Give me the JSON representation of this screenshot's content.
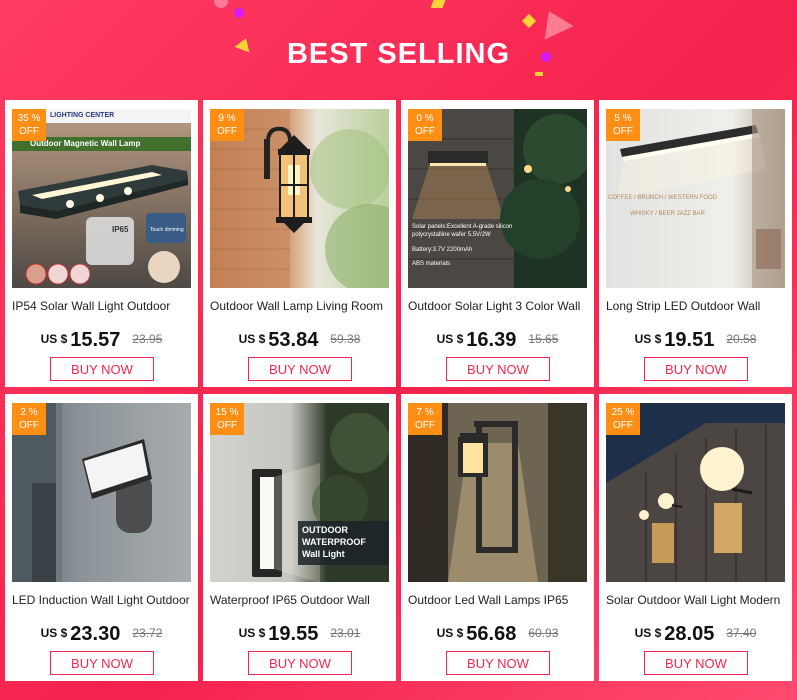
{
  "header": {
    "title": "BEST SELLING"
  },
  "currency": "US $",
  "buy_label": "BUY NOW",
  "colors": {
    "accent": "#f4284f",
    "badge": "#ff8e14",
    "background": "#f4224d"
  },
  "products": [
    {
      "discount": "35 %",
      "off": "OFF",
      "name": "IP54 Solar Wall Light Outdoor",
      "price": "15.57",
      "old_price": "23.95",
      "image_text": {
        "brand": "LIGHTING CENTER",
        "headline": "Outdoor Magnetic Wall Lamp",
        "rating": "IP65",
        "note": "Touch dimming"
      }
    },
    {
      "discount": "9 %",
      "off": "OFF",
      "name": "Outdoor Wall Lamp Living Room",
      "price": "53.84",
      "old_price": "59.38"
    },
    {
      "discount": "0 %",
      "off": "OFF",
      "name": "Outdoor Solar Light 3 Color Wall",
      "price": "16.39",
      "old_price": "15.65",
      "image_text": {
        "spec1": "Solar panels:Excellent A-grade silicon polycrystalline wafer 5.5V/2W",
        "spec2": "Battery:3.7V 2200mAh",
        "spec3": "ABS materials"
      }
    },
    {
      "discount": "5 %",
      "off": "OFF",
      "name": "Long Strip LED Outdoor Wall",
      "price": "19.51",
      "old_price": "20.58",
      "image_text": {
        "line1": "COFFEE / BRUNCH / WESTERN FOOD",
        "line2": "WHISKY / BEER JAZZ BAR"
      }
    },
    {
      "discount": "2 %",
      "off": "OFF",
      "name": "LED Induction Wall Light Outdoor",
      "price": "23.30",
      "old_price": "23.72"
    },
    {
      "discount": "15 %",
      "off": "OFF",
      "name": "Waterproof IP65 Outdoor Wall",
      "price": "19.55",
      "old_price": "23.01",
      "image_text": {
        "line1": "OUTDOOR",
        "line2": "WATERPROOF",
        "line3": "Wall Light"
      }
    },
    {
      "discount": "7 %",
      "off": "OFF",
      "name": "Outdoor Led Wall Lamps IP65",
      "price": "56.68",
      "old_price": "60.93"
    },
    {
      "discount": "25 %",
      "off": "OFF",
      "name": "Solar Outdoor Wall Light Modern",
      "price": "28.05",
      "old_price": "37.40"
    }
  ]
}
